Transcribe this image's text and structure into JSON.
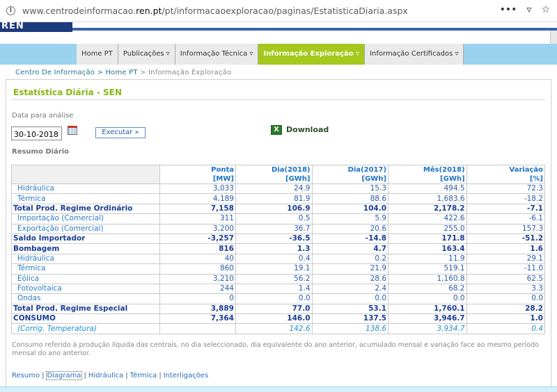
{
  "browser": {
    "url_prefix": "www.centrodeinformacao.",
    "url_domain": "ren.pt",
    "url_suffix": "/pt/informacaoexploracao/paginas/EstatisticaDiaria.aspx",
    "more_label": "•••"
  },
  "logo": {
    "text": "REN"
  },
  "nav": {
    "items": [
      {
        "label": "Home PT"
      },
      {
        "label": "Publicações ▿"
      },
      {
        "label": "Informação Técnica ▿"
      },
      {
        "label": "Informação Exploração ▿"
      },
      {
        "label": "Informação Certificados ▿"
      }
    ]
  },
  "breadcrumb": {
    "part1": "Centro De Informação",
    "sep1": " > ",
    "part2": "Home PT",
    "sep2": " > ",
    "part3": "Informação Exploração"
  },
  "page": {
    "title": "Estatística Diária - SEN",
    "date_label": "Data para análise",
    "date_value": "30-10-2018",
    "execute_label": "Executar »",
    "download_label": "Download",
    "summary_label": "Resumo Diário"
  },
  "table": {
    "headers": [
      {
        "name": "Ponta",
        "unit": "[MW]"
      },
      {
        "name": "Dia(2018)",
        "unit": "[GWh]"
      },
      {
        "name": "Dia(2017)",
        "unit": "[GWh]"
      },
      {
        "name": "Mês(2018)",
        "unit": "[GWh]"
      },
      {
        "name": "Variação",
        "unit": "[%]"
      }
    ],
    "rows": [
      {
        "label": "Hidráulica",
        "values": [
          "3,033",
          "24.9",
          "15.3",
          "494.5",
          "72.3"
        ]
      },
      {
        "label": "Térmica",
        "values": [
          "4,189",
          "81.9",
          "88.6",
          "1,683.6",
          "-18.2"
        ]
      },
      {
        "label": "Total Prod. Regime Ordinário",
        "values": [
          "7,158",
          "106.9",
          "104.0",
          "2,178.2",
          "-7.1"
        ]
      },
      {
        "label": "Importação (Comercial)",
        "values": [
          "311",
          "0.5",
          "5.9",
          "422.6",
          "-6.1"
        ]
      },
      {
        "label": "Exportação (Comercial)",
        "values": [
          "3,200",
          "36.7",
          "20.6",
          "255.0",
          "157.3"
        ]
      },
      {
        "label": "Saldo Importador",
        "values": [
          "-3,257",
          "-36.5",
          "-14.8",
          "171.8",
          "-51.2"
        ]
      },
      {
        "label": "Bombagem",
        "values": [
          "816",
          "1.3",
          "4.7",
          "163.4",
          "1.6"
        ]
      },
      {
        "label": "Hidráulica",
        "values": [
          "40",
          "0.4",
          "0.2",
          "11.9",
          "29.1"
        ]
      },
      {
        "label": "Térmica",
        "values": [
          "860",
          "19.1",
          "21.9",
          "519.1",
          "-11.0"
        ]
      },
      {
        "label": "Eólica",
        "values": [
          "3,210",
          "56.2",
          "28.6",
          "1,160.8",
          "62.5"
        ]
      },
      {
        "label": "Fotovoltaica",
        "values": [
          "244",
          "1.4",
          "2.4",
          "68.2",
          "3.3"
        ]
      },
      {
        "label": "Ondas",
        "values": [
          "0",
          "0.0",
          "0.0",
          "0.0",
          "0.0"
        ]
      },
      {
        "label": "Total Prod. Regime Especial",
        "values": [
          "3,889",
          "77.0",
          "53.1",
          "1,760.1",
          "28.2"
        ]
      },
      {
        "label": "CONSUMO",
        "values": [
          "7,364",
          "146.0",
          "137.5",
          "3,946.7",
          "1.0"
        ]
      },
      {
        "label": "(Corrig. Temperatura)",
        "values": [
          "",
          "142.6",
          "138.6",
          "3,934.7",
          "0.4"
        ]
      }
    ]
  },
  "footnote": "Consumo referido à produção líquida das centrais, no dia seleccionado, dia equivalente do ano anterior, acumulado mensal e variação face ao mesmo período mensal do ano anterior.",
  "links": {
    "items": [
      "Resumo",
      "Diagrama",
      "Hidráulica",
      "Térmica",
      "Interligações"
    ],
    "separator": "|"
  }
}
